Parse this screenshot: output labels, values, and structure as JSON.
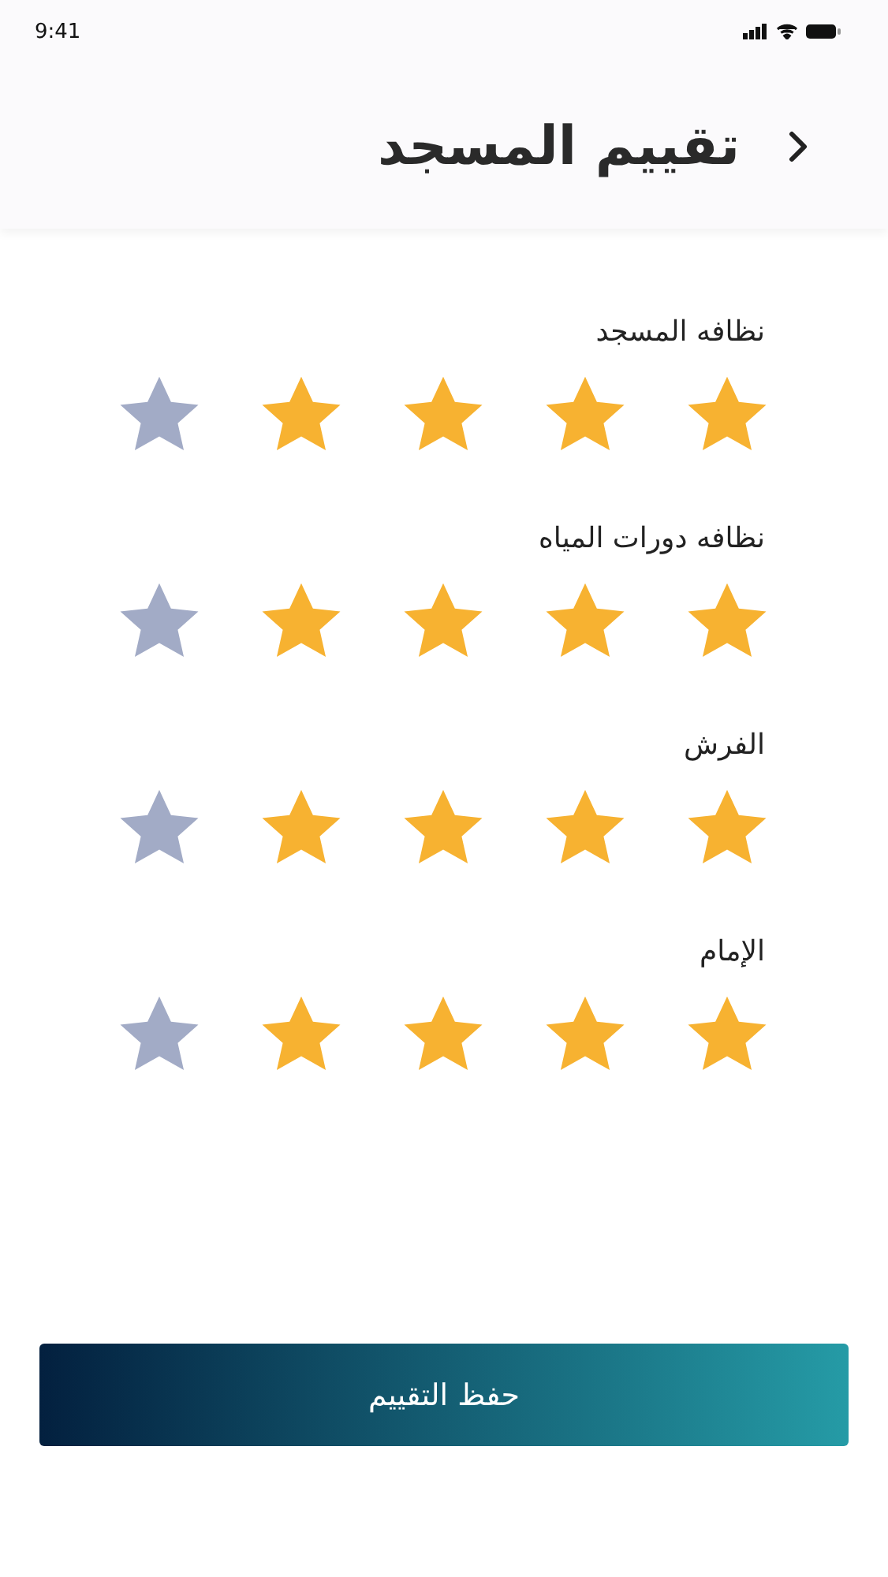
{
  "status_bar": {
    "time": "9:41"
  },
  "header": {
    "title": "تقييم المسجد"
  },
  "ratings": [
    {
      "label": "نظافه المسجد",
      "stars": 4
    },
    {
      "label": "نظافه دورات المياه",
      "stars": 4
    },
    {
      "label": "الفرش",
      "stars": 4
    },
    {
      "label": "الإمام",
      "stars": 4
    }
  ],
  "save_button": {
    "label": "حفظ التقييم"
  }
}
